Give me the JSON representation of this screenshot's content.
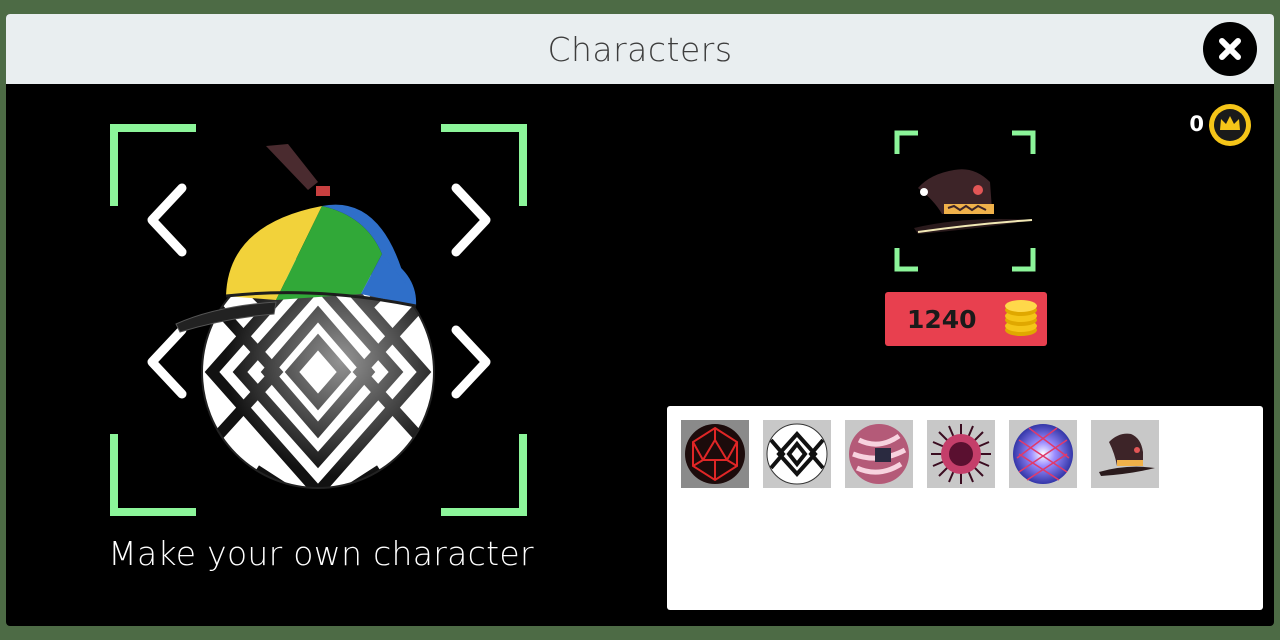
{
  "header": {
    "title": "Characters",
    "close_icon": "close-icon"
  },
  "wallet": {
    "coins": "0",
    "coin_icon": "crown-coin-icon",
    "coin_color": "#f5c518"
  },
  "preview": {
    "caption": "Make your own character",
    "accent": "#8cf59a",
    "hat_icon": "propeller-cap-icon",
    "ball_icon": "op-art-ball-icon",
    "prev_hat_icon": "chevron-left-icon",
    "next_hat_icon": "chevron-right-icon",
    "prev_ball_icon": "chevron-left-icon",
    "next_ball_icon": "chevron-right-icon"
  },
  "shop": {
    "item_icon": "witch-hat-icon",
    "price": "1240",
    "price_icon": "coin-stack-icon",
    "price_bg": "#e8404f"
  },
  "inventory": {
    "items": [
      {
        "icon": "red-geodesic-ball-icon"
      },
      {
        "icon": "op-art-ball-icon"
      },
      {
        "icon": "striped-pink-ball-icon"
      },
      {
        "icon": "spiky-ball-icon"
      },
      {
        "icon": "glowing-blue-ball-icon"
      },
      {
        "icon": "witch-hat-icon"
      }
    ]
  }
}
